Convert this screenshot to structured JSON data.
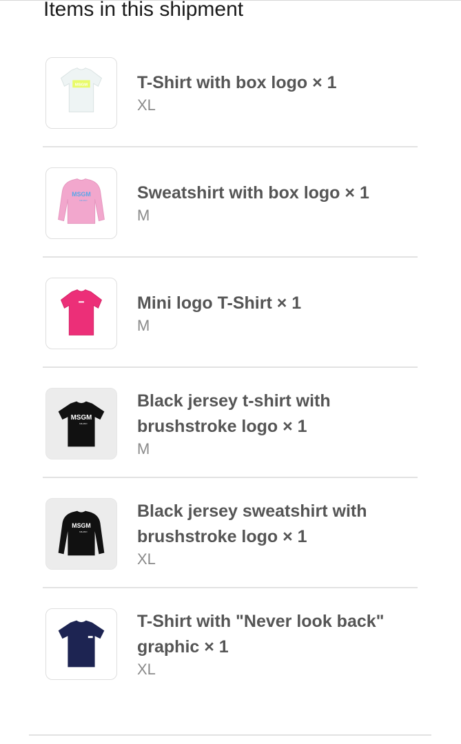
{
  "shipment": {
    "title": "Items in this shipment",
    "items": [
      {
        "name": "T-Shirt with box logo × 1",
        "size": "XL",
        "icon": "white-tshirt-icon",
        "colors": {
          "garment": "#eef4f4",
          "print": "#e9fb6a",
          "background": "#ffffff"
        },
        "print_text": "MSGM"
      },
      {
        "name": "Sweatshirt with box logo × 1",
        "size": "M",
        "icon": "pink-sweatshirt-icon",
        "colors": {
          "garment": "#f2a7cd",
          "print": "#5aa6e8",
          "background": "#ffffff"
        },
        "print_text": "MSGM"
      },
      {
        "name": "Mini logo T-Shirt × 1",
        "size": "M",
        "icon": "pink-tshirt-icon",
        "colors": {
          "garment": "#ec2f78",
          "print": "#ffffff",
          "background": "#ffffff"
        },
        "print_text": ""
      },
      {
        "name": "Black jersey t-shirt with brushstroke logo × 1",
        "size": "M",
        "icon": "black-tshirt-icon",
        "colors": {
          "garment": "#111111",
          "print": "#ffffff",
          "background": "#ececec"
        },
        "print_text": "MSGM"
      },
      {
        "name": "Black jersey sweatshirt with brushstroke logo × 1",
        "size": "XL",
        "icon": "black-sweatshirt-icon",
        "colors": {
          "garment": "#111111",
          "print": "#ffffff",
          "background": "#ececec"
        },
        "print_text": "MSGM"
      },
      {
        "name": "T-Shirt with \"Never look back\" graphic × 1",
        "size": "XL",
        "icon": "navy-tshirt-icon",
        "colors": {
          "garment": "#1d2452",
          "print": "#ffffff",
          "background": "#ffffff"
        },
        "print_text": ""
      }
    ]
  },
  "colors": {
    "title_text": "#1a1a1a",
    "item_name_text": "#555555",
    "item_size_text": "#8a8a8a",
    "divider": "#e2e2e2"
  }
}
